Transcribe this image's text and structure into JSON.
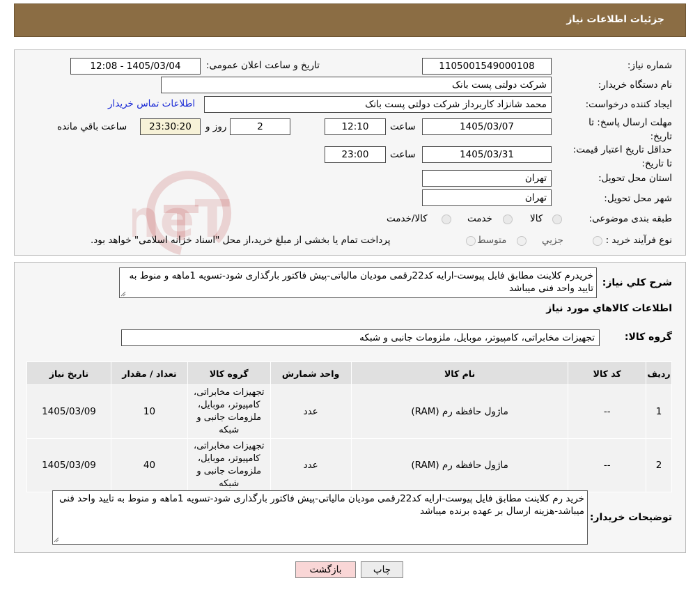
{
  "header": {
    "title": "جزئیات اطلاعات نیاز"
  },
  "fields": {
    "need_number_label": "شماره نیاز:",
    "need_number": "1105001549000108",
    "announce_label": "تاریخ و ساعت اعلان عمومی:",
    "announce_value": "1405/03/04 - 12:08",
    "buyer_org_label": "نام دستگاه خریدار:",
    "buyer_org": "شرکت دولتی پست بانک",
    "creator_label": "ایجاد کننده درخواست:",
    "creator": "محمد شانزاد کاربرداز شرکت دولتی پست بانک",
    "contact_link": "اطلاعات تماس خریدار",
    "deadline_label": "مهلت ارسال پاسخ: تا تاریخ:",
    "deadline_date": "1405/03/07",
    "time_label": "ساعت",
    "deadline_time": "12:10",
    "days_value": "2",
    "days_label": "روز و",
    "remaining_time": "23:30:20",
    "remaining_label": "ساعت باقي مانده",
    "validity_label": "حداقل تاریخ اعتبار قیمت: تا تاریخ:",
    "validity_date": "1405/03/31",
    "validity_time": "23:00",
    "province_label": "استان محل تحویل:",
    "province": "تهران",
    "city_label": "شهر محل تحویل:",
    "city": "تهران",
    "category_label": "طبقه بندی موضوعی:",
    "category_options": [
      "کالا",
      "خدمت",
      "کالا/خدمت"
    ],
    "process_label": "نوع فرآیند خرید :",
    "process_options": [
      "جزیي",
      "متوسط"
    ],
    "process_note": "پرداخت تمام یا بخشی از مبلغ خرید،از محل \"اسناد خزانه اسلامی\" خواهد بود."
  },
  "description": {
    "label": "شرح کلي نیاز:",
    "text": "خریدرم کلاینت مطابق فایل پیوست-ارایه کد22رقمی مودیان مالیاتی-پیش فاکتور بارگذاری شود-تسویه 1ماهه و منوط به تایید واحد فنی میباشد"
  },
  "goods": {
    "section_title": "اطلاعات کالاهاي مورد نياز",
    "group_label": "گروه کالا:",
    "group_value": "تجهیزات مخابراتی، کامپیوتر، موبایل، ملزومات جانبی و شبکه",
    "columns": [
      "ردیف",
      "کد کالا",
      "نام کالا",
      "واحد شمارش",
      "گروه کالا",
      "تعداد / مقدار",
      "تاریخ نیاز"
    ],
    "rows": [
      {
        "index": "1",
        "code": "--",
        "name": "ماژول حافظه رم (RAM)",
        "unit": "عدد",
        "group": "تجهیزات مخابراتی، کامپیوتر، موبایل، ملزومات جانبی و شبکه",
        "qty": "10",
        "date": "1405/03/09"
      },
      {
        "index": "2",
        "code": "--",
        "name": "ماژول حافظه رم (RAM)",
        "unit": "عدد",
        "group": "تجهیزات مخابراتی، کامپیوتر، موبایل، ملزومات جانبی و شبکه",
        "qty": "40",
        "date": "1405/03/09"
      }
    ]
  },
  "buyer_notes": {
    "label": "توضیحات خریدار:",
    "text": "خرید رم کلاینت مطابق فایل پیوست-ارایه کد22رقمی مودیان مالیاتی-پیش فاکتور بارگذاری شود-تسویه 1ماهه و منوط به تایید واحد فنی میباشد-هزینه ارسال بر عهده برنده میباشد"
  },
  "buttons": {
    "print": "چاپ",
    "back": "بازگشت"
  },
  "watermark": {
    "text": "AriaTender.neT"
  },
  "colors": {
    "header": "#8b6d44",
    "link": "#1b2bd6",
    "back_button": "#f9d6d6",
    "print_button": "#ececec"
  }
}
